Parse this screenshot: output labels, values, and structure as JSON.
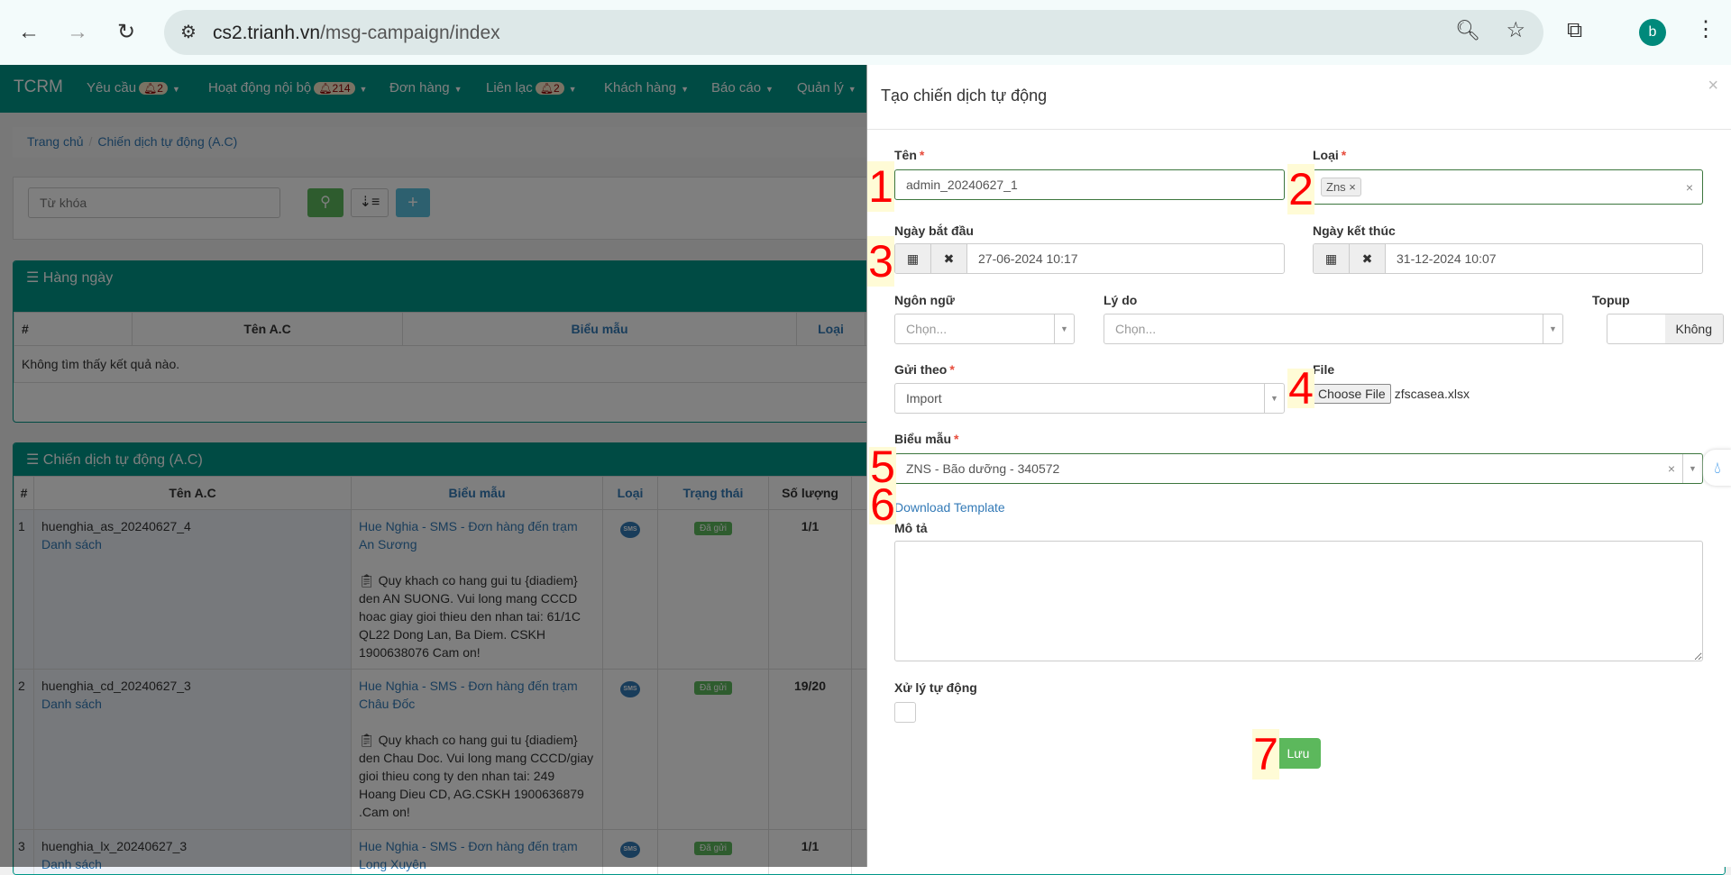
{
  "browser": {
    "url_host": "cs2.trianh.vn",
    "url_path": "/msg-campaign/index",
    "avatar": "b",
    "icons": [
      "back-icon",
      "forward-icon",
      "reload-icon",
      "site-settings-icon",
      "zoom-icon",
      "star-icon",
      "extensions-icon",
      "menu-icon"
    ]
  },
  "nav": {
    "brand": "TCRM",
    "items": [
      {
        "label": "Yêu cầu",
        "badge": "2"
      },
      {
        "label": "Hoạt động nội bộ",
        "badge": "214"
      },
      {
        "label": "Đơn hàng"
      },
      {
        "label": "Liên lạc",
        "badge": "2"
      },
      {
        "label": "Khách hàng"
      },
      {
        "label": "Báo cáo"
      },
      {
        "label": "Quản lý"
      }
    ]
  },
  "breadcrumb": {
    "home": "Trang chủ",
    "current": "Chiến dịch tự động (A.C)"
  },
  "search": {
    "placeholder": "Từ khóa"
  },
  "daily": {
    "title": "Hàng ngày",
    "headers": [
      "#",
      "Tên A.C",
      "Biểu mẫu",
      "Loại"
    ],
    "empty": "Không tìm thấy kết quả nào."
  },
  "campaigns": {
    "title": "Chiến dịch tự động (A.C)",
    "headers": [
      "#",
      "Tên A.C",
      "Biểu mẫu",
      "Loại",
      "Trạng thái",
      "Số lượng"
    ],
    "rows": [
      {
        "no": "1",
        "name": "huenghia_as_20240627_4",
        "link": "Danh sách",
        "template": "Hue Nghia - SMS - Đơn hàng đến trạm An Sương",
        "content": "Quy khach co hang gui tu {diadiem} den AN SUONG. Vui long mang CCCD hoac giay gioi thieu den nhan tai: 61/1C QL22 Dong Lan, Ba Diem. CSKH 1900638076 Cam on!",
        "type": "SMS",
        "status": "Đã gửi",
        "qty": "1/1"
      },
      {
        "no": "2",
        "name": "huenghia_cd_20240627_3",
        "link": "Danh sách",
        "template": "Hue Nghia - SMS - Đơn hàng đến trạm Châu Đốc",
        "content": "Quy khach co hang gui tu {diadiem} den Chau Doc. Vui long mang CCCD/giay gioi thieu cong ty den nhan tai: 249 Hoang Dieu CD, AG.CSKH 1900636879 .Cam on!",
        "type": "SMS",
        "status": "Đã gửi",
        "qty": "19/20"
      },
      {
        "no": "3",
        "name": "huenghia_lx_20240627_3",
        "link": "Danh sách",
        "template": "Hue Nghia - SMS - Đơn hàng đến trạm Long Xuyên",
        "content": "",
        "type": "SMS",
        "status": "Đã gửi",
        "qty": "1/1"
      }
    ]
  },
  "modal": {
    "title": "Tạo chiến dịch tự động",
    "close": "×",
    "name_label": "Tên",
    "name_value": "admin_20240627_1",
    "type_label": "Loại",
    "type_tag": "Zns",
    "start_label": "Ngày bắt đầu",
    "start_value": "27-06-2024 10:17",
    "end_label": "Ngày kết thúc",
    "end_value": "31-12-2024 10:07",
    "lang_label": "Ngôn ngữ",
    "lang_placeholder": "Chọn...",
    "reason_label": "Lý do",
    "reason_placeholder": "Chọn...",
    "topup_label": "Topup",
    "topup_addon": "Không",
    "send_label": "Gửi theo",
    "send_value": "Import",
    "file_label": "File",
    "file_button": "Choose File",
    "file_name": "zfscasea.xlsx",
    "template_label": "Biểu mẫu",
    "template_value": "ZNS - Bão dưỡng - 340572",
    "download": "Download Template",
    "desc_label": "Mô tả",
    "auto_label": "Xử lý tự động",
    "auto_checked": false,
    "save": "Lưu"
  },
  "markers": [
    "1",
    "2",
    "3",
    "4",
    "5",
    "6",
    "7"
  ]
}
